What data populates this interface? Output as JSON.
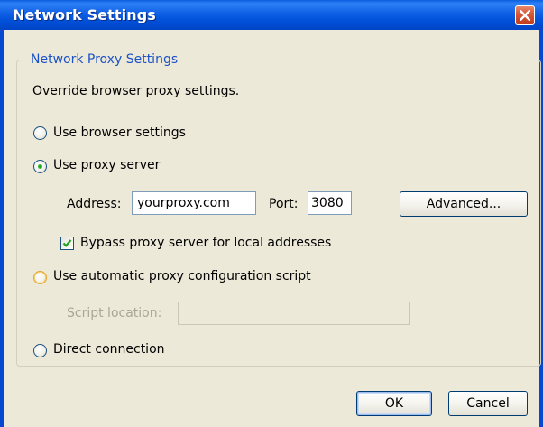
{
  "window": {
    "title": "Network Settings"
  },
  "group": {
    "title": "Network Proxy Settings"
  },
  "intro_text": "Override browser proxy settings.",
  "options": {
    "browser_settings": "Use browser settings",
    "proxy_server": "Use proxy server",
    "auto_script": "Use automatic proxy configuration script",
    "direct": "Direct connection",
    "selected": "proxy_server"
  },
  "proxy": {
    "address_label": "Address:",
    "address_value": "yourproxy.com",
    "port_label": "Port:",
    "port_value": "3080",
    "advanced_label": "Advanced...",
    "bypass_label": "Bypass proxy server for local addresses",
    "bypass_checked": true
  },
  "script": {
    "location_label": "Script location:",
    "location_value": ""
  },
  "buttons": {
    "ok": "OK",
    "cancel": "Cancel"
  },
  "colors": {
    "titlebar": "#0a5fe0",
    "group_title": "#1c52c8",
    "window_bg": "#ece9d8",
    "radio_dot": "#21a121"
  }
}
